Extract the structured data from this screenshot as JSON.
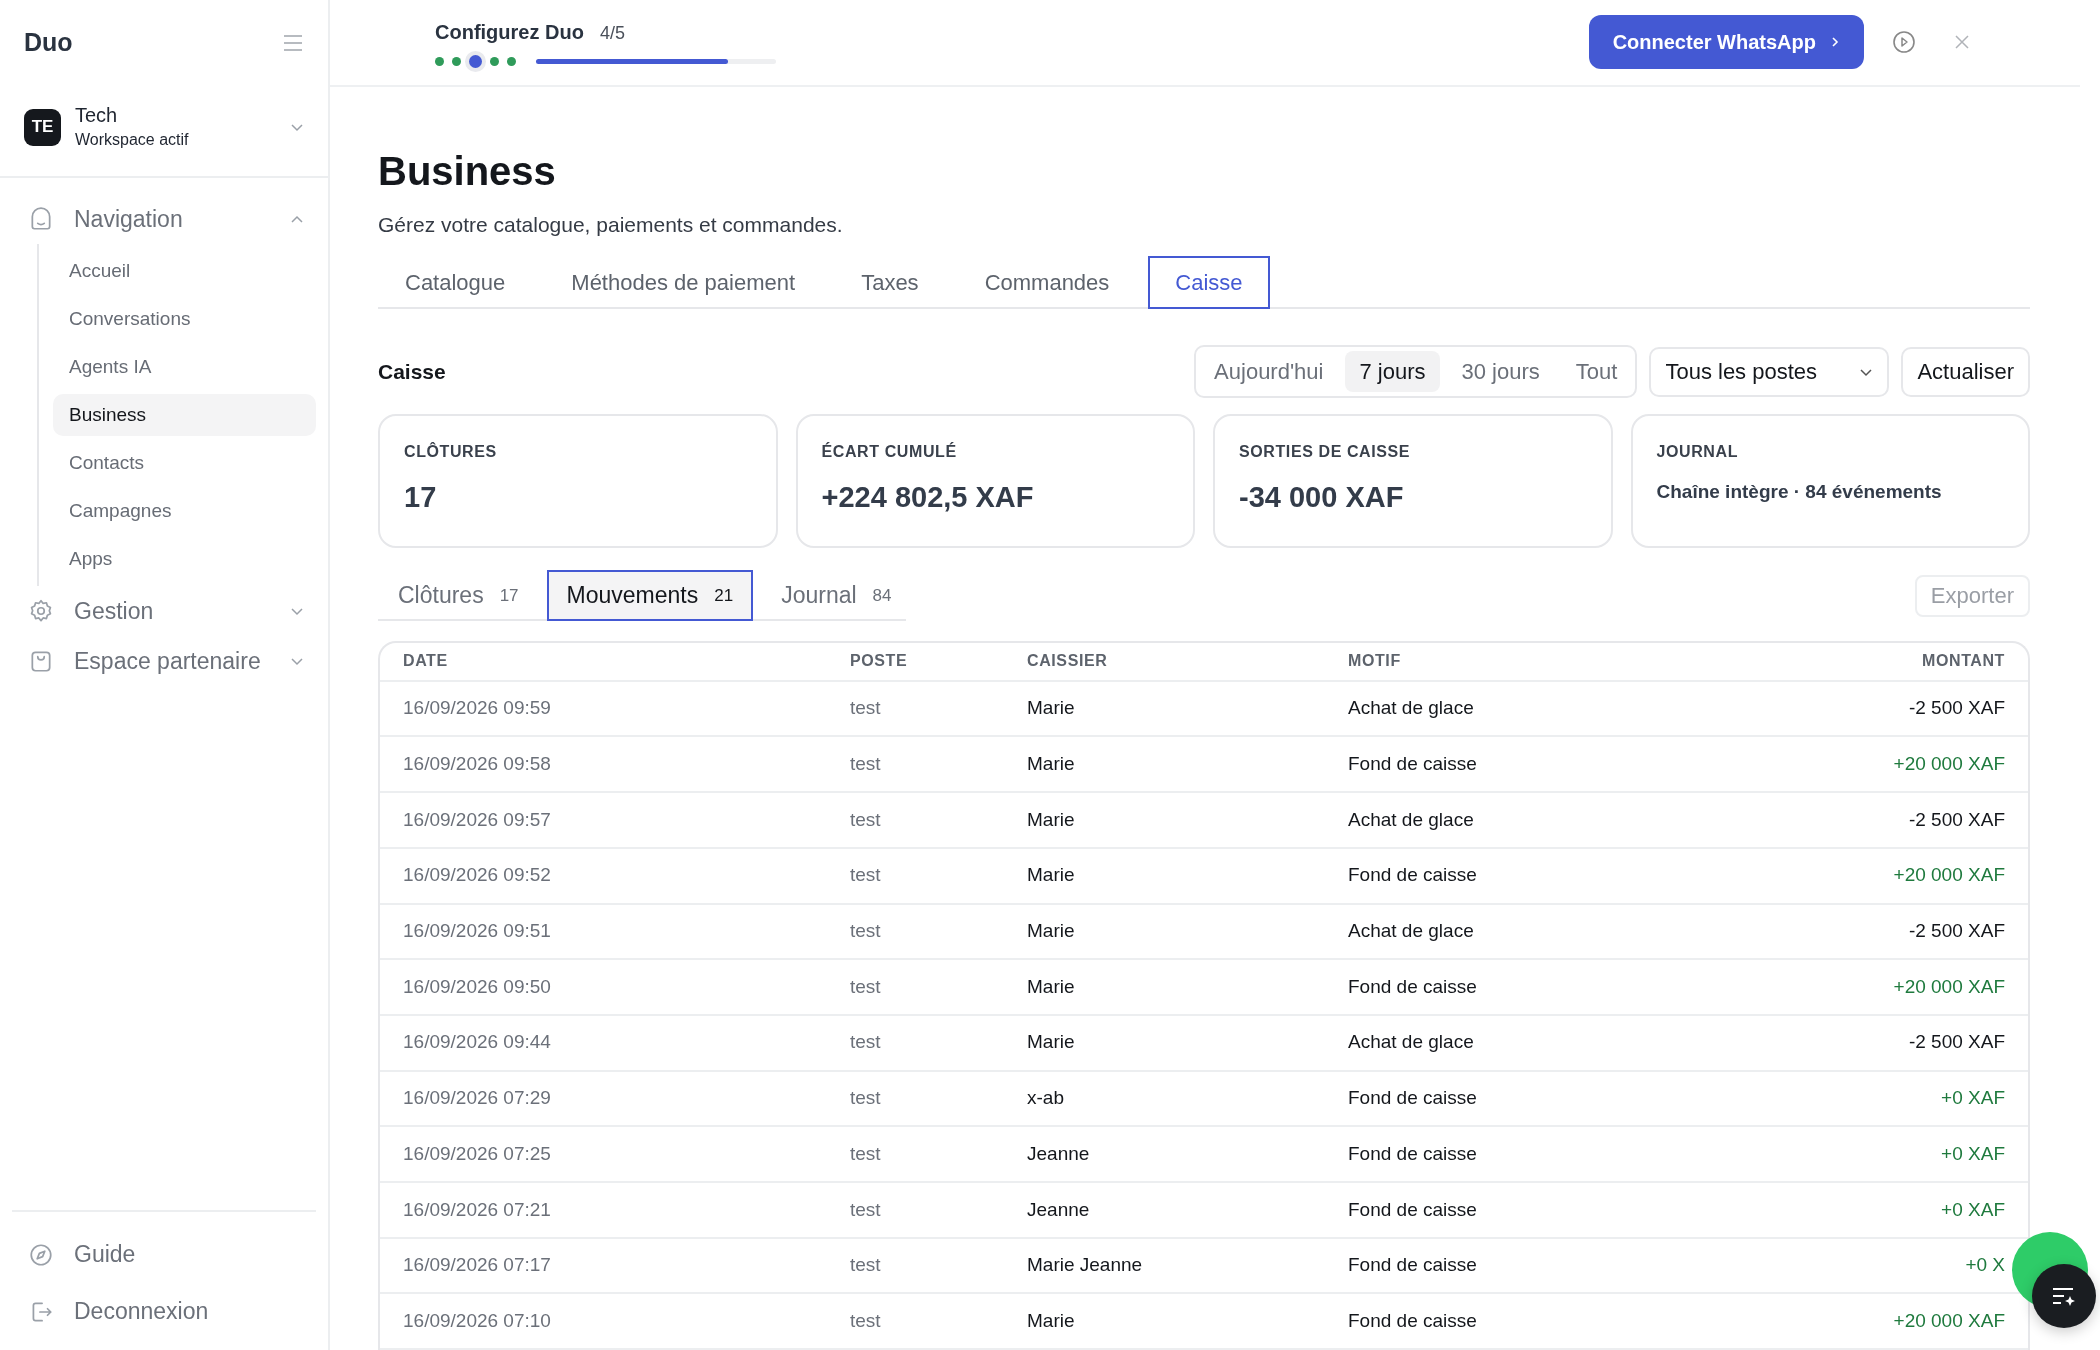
{
  "sidebar": {
    "brand": "Duo",
    "workspace": {
      "initials": "TE",
      "name": "Tech",
      "subtitle": "Workspace actif"
    },
    "groups": [
      {
        "label": "Navigation",
        "expanded": true,
        "items": [
          {
            "label": "Accueil",
            "selected": false
          },
          {
            "label": "Conversations",
            "selected": false
          },
          {
            "label": "Agents IA",
            "selected": false
          },
          {
            "label": "Business",
            "selected": true
          },
          {
            "label": "Contacts",
            "selected": false
          },
          {
            "label": "Campagnes",
            "selected": false
          },
          {
            "label": "Apps",
            "selected": false
          }
        ]
      },
      {
        "label": "Gestion",
        "expanded": false
      },
      {
        "label": "Espace partenaire",
        "expanded": false
      }
    ],
    "footer": [
      {
        "label": "Guide"
      },
      {
        "label": "Deconnexion"
      }
    ]
  },
  "setup": {
    "title": "Configurez Duo",
    "count": "4/5",
    "steps": [
      {
        "current": false
      },
      {
        "current": false
      },
      {
        "current": true
      },
      {
        "current": false
      },
      {
        "current": false
      }
    ],
    "level": 0.8,
    "cta": "Connecter WhatsApp"
  },
  "page": {
    "title": "Business",
    "subtitle": "Gérez votre catalogue, paiements et commandes.",
    "tabs": [
      {
        "label": "Catalogue",
        "selected": false
      },
      {
        "label": "Méthodes de paiement",
        "selected": false
      },
      {
        "label": "Taxes",
        "selected": false
      },
      {
        "label": "Commandes",
        "selected": false
      },
      {
        "label": "Caisse",
        "selected": true
      }
    ]
  },
  "caisse": {
    "title": "Caisse",
    "periods": [
      {
        "label": "Aujourd'hui",
        "selected": false
      },
      {
        "label": "7 jours",
        "selected": true
      },
      {
        "label": "30 jours",
        "selected": false
      },
      {
        "label": "Tout",
        "selected": false
      }
    ],
    "post_filter": "Tous les postes",
    "refresh": "Actualiser",
    "stats": [
      {
        "label": "CLÔTURES",
        "value": "17",
        "kind": "big"
      },
      {
        "label": "ÉCART CUMULÉ",
        "value": "+224 802,5 XAF",
        "kind": "big"
      },
      {
        "label": "SORTIES DE CAISSE",
        "value": "-34 000 XAF",
        "kind": "big"
      },
      {
        "label": "JOURNAL",
        "value": "Chaîne intègre · 84 événements",
        "kind": "text"
      }
    ],
    "subtabs": [
      {
        "label": "Clôtures",
        "count": "17",
        "selected": false
      },
      {
        "label": "Mouvements",
        "count": "21",
        "selected": true
      },
      {
        "label": "Journal",
        "count": "84",
        "selected": false
      }
    ],
    "export": {
      "label": "Exporter",
      "disabled": true
    },
    "table": {
      "columns": [
        "DATE",
        "POSTE",
        "CAISSIER",
        "MOTIF",
        "MONTANT"
      ],
      "rows": [
        {
          "date": "16/09/2026 09:59",
          "poste": "test",
          "caissier": "Marie",
          "motif": "Achat de glace",
          "amount": "-2 500 XAF",
          "kind": "out"
        },
        {
          "date": "16/09/2026 09:58",
          "poste": "test",
          "caissier": "Marie",
          "motif": "Fond de caisse",
          "amount": "+20 000 XAF",
          "kind": "in"
        },
        {
          "date": "16/09/2026 09:57",
          "poste": "test",
          "caissier": "Marie",
          "motif": "Achat de glace",
          "amount": "-2 500 XAF",
          "kind": "out"
        },
        {
          "date": "16/09/2026 09:52",
          "poste": "test",
          "caissier": "Marie",
          "motif": "Fond de caisse",
          "amount": "+20 000 XAF",
          "kind": "in"
        },
        {
          "date": "16/09/2026 09:51",
          "poste": "test",
          "caissier": "Marie",
          "motif": "Achat de glace",
          "amount": "-2 500 XAF",
          "kind": "out"
        },
        {
          "date": "16/09/2026 09:50",
          "poste": "test",
          "caissier": "Marie",
          "motif": "Fond de caisse",
          "amount": "+20 000 XAF",
          "kind": "in"
        },
        {
          "date": "16/09/2026 09:44",
          "poste": "test",
          "caissier": "Marie",
          "motif": "Achat de glace",
          "amount": "-2 500 XAF",
          "kind": "out"
        },
        {
          "date": "16/09/2026 07:29",
          "poste": "test",
          "caissier": "x-ab",
          "motif": "Fond de caisse",
          "amount": "+0 XAF",
          "kind": "in"
        },
        {
          "date": "16/09/2026 07:25",
          "poste": "test",
          "caissier": "Jeanne",
          "motif": "Fond de caisse",
          "amount": "+0 XAF",
          "kind": "in"
        },
        {
          "date": "16/09/2026 07:21",
          "poste": "test",
          "caissier": "Jeanne",
          "motif": "Fond de caisse",
          "amount": "+0 XAF",
          "kind": "in"
        },
        {
          "date": "16/09/2026 07:17",
          "poste": "test",
          "caissier": "Marie Jeanne",
          "motif": "Fond de caisse",
          "amount": "+0 X",
          "kind": "in"
        },
        {
          "date": "16/09/2026 07:10",
          "poste": "test",
          "caissier": "Marie",
          "motif": "Fond de caisse",
          "amount": "+20 000 XAF",
          "kind": "in"
        }
      ]
    }
  }
}
